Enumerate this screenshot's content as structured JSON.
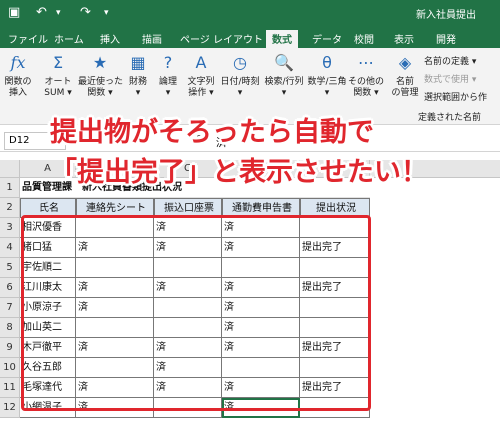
{
  "titlebar": {
    "title": "新入社員提出",
    "save_icon": "save-icon",
    "undo_icon": "undo-icon",
    "redo_icon": "redo-icon"
  },
  "ribbon_tabs": [
    "ファイル",
    "ホーム",
    "挿入",
    "描画",
    "ページ レイアウト",
    "数式",
    "データ",
    "校閲",
    "表示",
    "開発"
  ],
  "active_tab": "数式",
  "ribbon": {
    "buttons": [
      {
        "icon": "fx",
        "label": "関数の\n挿入"
      },
      {
        "icon": "Σ",
        "label": "オート\nSUM ▾"
      },
      {
        "icon": "★",
        "label": "最近使った\n関数 ▾"
      },
      {
        "icon": "▦",
        "label": "財務\n▾"
      },
      {
        "icon": "?",
        "label": "論理\n▾"
      },
      {
        "icon": "A",
        "label": "文字列\n操作 ▾"
      },
      {
        "icon": "◷",
        "label": "日付/時刻\n▾"
      },
      {
        "icon": "🔍",
        "label": "検索/行列\n▾"
      },
      {
        "icon": "θ",
        "label": "数学/三角\n▾"
      },
      {
        "icon": "⋯",
        "label": "その他の\n関数 ▾"
      },
      {
        "icon": "◈",
        "label": "名前\nの管理"
      }
    ],
    "names_group": {
      "define": "名前の定義 ▾",
      "use_in_formula": "数式で使用 ▾",
      "create_from_sel": "選択範囲から作",
      "group_label": "定義された名前"
    }
  },
  "formula_bar": {
    "name_box": "D12",
    "fx": "fx",
    "value": "済"
  },
  "columns": [
    "A",
    "B",
    "C",
    "D",
    "E"
  ],
  "rows": [
    {
      "num": "1",
      "cells": [
        "品質管理課　新入社員書類提出状況",
        "",
        "",
        "",
        ""
      ]
    },
    {
      "num": "2",
      "cells": [
        "氏名",
        "連絡先シート",
        "振込口座票",
        "通勤費申告書",
        "提出状況"
      ]
    },
    {
      "num": "3",
      "cells": [
        "相沢優香",
        "",
        "済",
        "済",
        ""
      ]
    },
    {
      "num": "4",
      "cells": [
        "猪口猛",
        "済",
        "済",
        "済",
        "提出完了"
      ]
    },
    {
      "num": "5",
      "cells": [
        "宇佐順二",
        "",
        "",
        "",
        ""
      ]
    },
    {
      "num": "6",
      "cells": [
        "江川康太",
        "済",
        "済",
        "済",
        "提出完了"
      ]
    },
    {
      "num": "7",
      "cells": [
        "小原涼子",
        "済",
        "",
        "済",
        ""
      ]
    },
    {
      "num": "8",
      "cells": [
        "加山英二",
        "",
        "",
        "済",
        ""
      ]
    },
    {
      "num": "9",
      "cells": [
        "木戸徹平",
        "済",
        "済",
        "済",
        "提出完了"
      ]
    },
    {
      "num": "10",
      "cells": [
        "久谷五郎",
        "",
        "済",
        "",
        ""
      ]
    },
    {
      "num": "11",
      "cells": [
        "毛塚達代",
        "済",
        "済",
        "済",
        "提出完了"
      ]
    },
    {
      "num": "12",
      "cells": [
        "小網温子",
        "済",
        "",
        "済",
        ""
      ]
    }
  ],
  "overlay": {
    "line1": "提出物がそろったら自動で",
    "line2": "「提出完了」と表示させたい！"
  },
  "colors": {
    "excel_green": "#217346",
    "header_fill": "#dce6f1",
    "overlay_red": "#e0262d"
  }
}
